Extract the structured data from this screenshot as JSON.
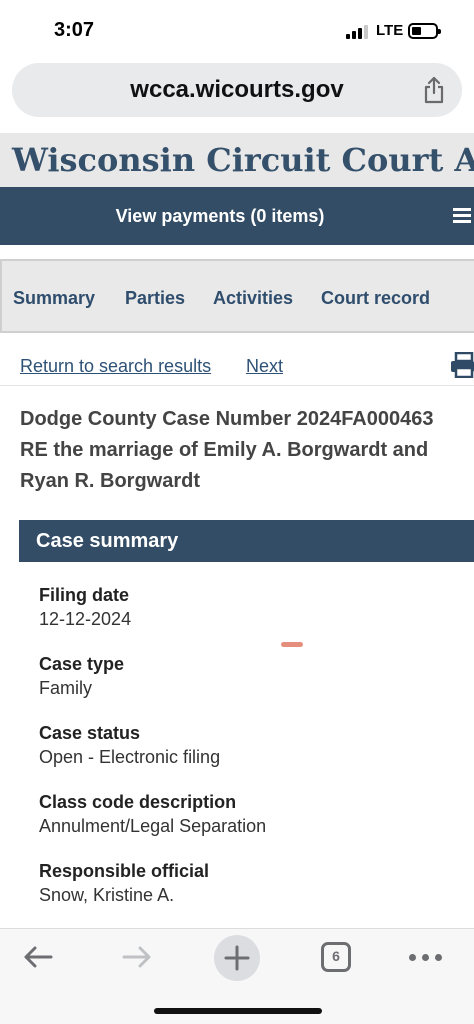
{
  "status_bar": {
    "time": "3:07",
    "network": "LTE",
    "signal_bars": 3,
    "signal_total": 4
  },
  "browser": {
    "url": "wcca.wicourts.gov",
    "tab_count": "6"
  },
  "site": {
    "title": "Wisconsin Circuit Court Acc",
    "payments_link": "View payments (0 items)"
  },
  "tabs": [
    "Summary",
    "Parties",
    "Activities",
    "Court record"
  ],
  "nav": {
    "return_link": "Return to search results",
    "next_link": "Next"
  },
  "case": {
    "heading_lines": [
      "Dodge County Case Number 2024FA000463",
      "RE the marriage of Emily A. Borgwardt and",
      "Ryan R. Borgwardt"
    ]
  },
  "summary": {
    "title": "Case summary",
    "fields": [
      {
        "label": "Filing date",
        "value": "12-12-2024"
      },
      {
        "label": "Case type",
        "value": "Family"
      },
      {
        "label": "Case status",
        "value": "Open - Electronic filing"
      },
      {
        "label": "Class code description",
        "value": "Annulment/Legal Separation"
      },
      {
        "label": "Responsible official",
        "value": "Snow, Kristine A."
      }
    ]
  },
  "colors": {
    "header_blue": "#344d66",
    "title_blue": "#35506b",
    "link_blue": "#2e5276",
    "tab_blue": "#2f4d6d"
  },
  "icons": [
    "share-icon",
    "menu-icon",
    "printer-icon",
    "back-arrow-icon",
    "forward-arrow-icon",
    "plus-icon",
    "tabs-icon",
    "more-icon"
  ]
}
